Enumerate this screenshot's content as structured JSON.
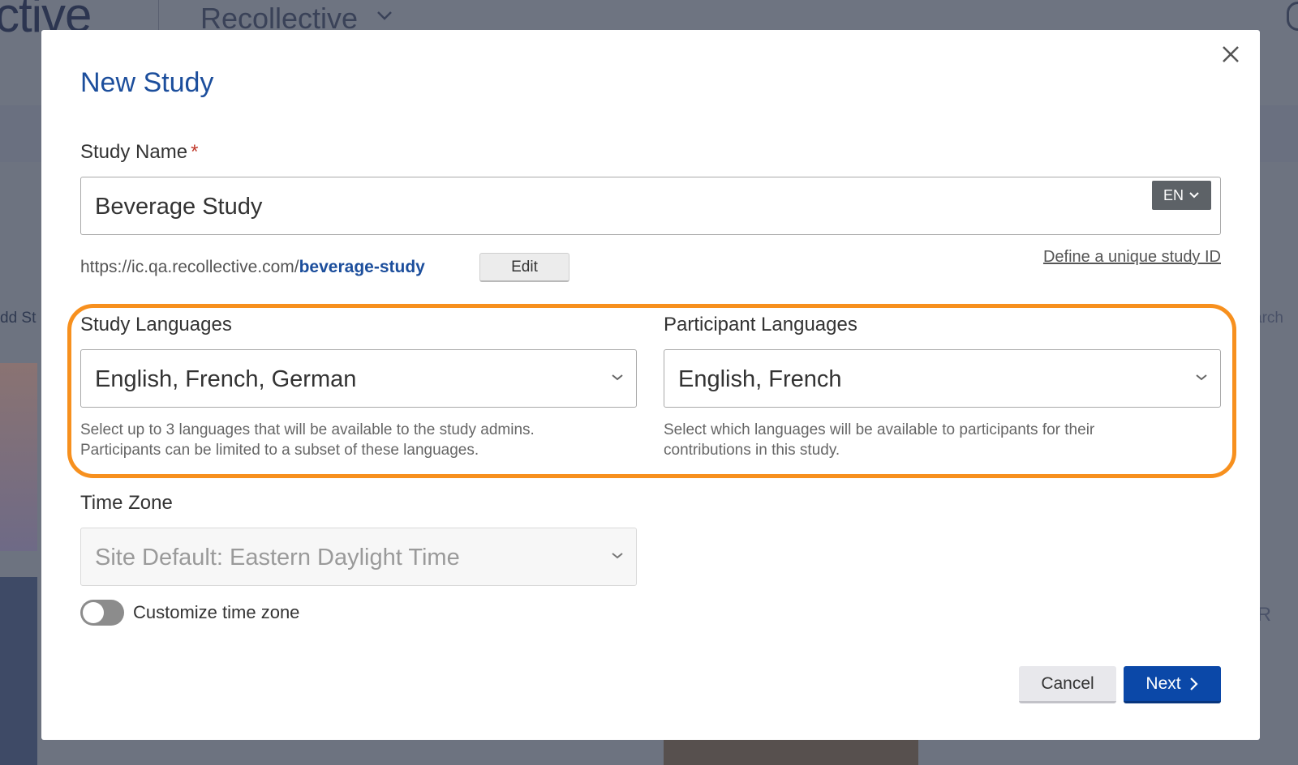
{
  "background": {
    "logo_text": "ctive",
    "app_name": "Recollective",
    "add_text": "dd St",
    "search_text": "arch",
    "fr_text": "FR"
  },
  "modal": {
    "title": "New Study",
    "study_name": {
      "label": "Study Name",
      "required_mark": "*",
      "value": "Beverage Study",
      "language_code": "EN"
    },
    "url": {
      "prefix": "https://ic.qa.recollective.com/",
      "slug": "beverage-study",
      "edit_label": "Edit",
      "define_link": "Define a unique study ID"
    },
    "study_languages": {
      "label": "Study Languages",
      "value": "English, French, German",
      "help_line1": "Select up to 3 languages that will be available to the study admins.",
      "help_line2": "Participants can be limited to a subset of these languages."
    },
    "participant_languages": {
      "label": "Participant Languages",
      "value": "English, French",
      "help_line1": "Select which languages will be available to participants for their",
      "help_line2": "contributions in this study."
    },
    "time_zone": {
      "label": "Time Zone",
      "value": "Site Default: Eastern Daylight Time",
      "disabled": true
    },
    "customize_time_zone": {
      "label": "Customize time zone",
      "enabled": false
    },
    "buttons": {
      "cancel": "Cancel",
      "next": "Next"
    }
  },
  "colors": {
    "title": "#1c4e9c",
    "highlight": "#f7901e",
    "primary_button": "#0b48a8",
    "required": "#c0392b"
  },
  "icons": {
    "close": "close-icon",
    "chevron": "chevron-down-icon",
    "next": "chevron-right-icon"
  }
}
